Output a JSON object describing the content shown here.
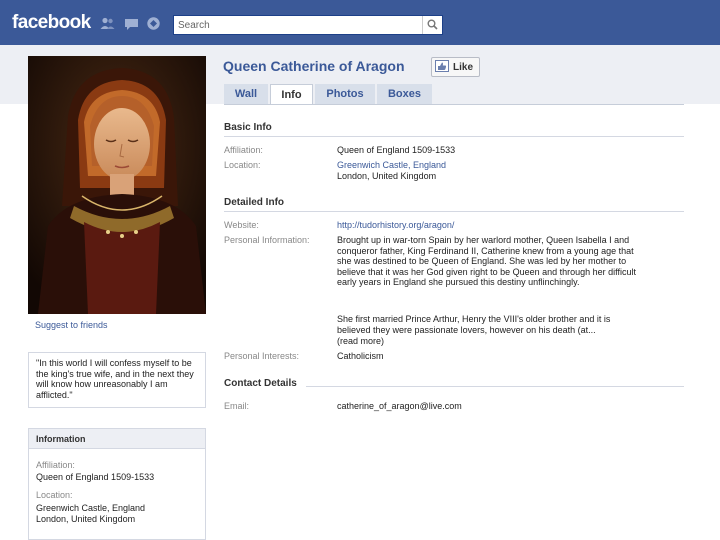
{
  "topbar": {
    "logo": "facebook",
    "icons": [
      "friends-icon",
      "messages-icon",
      "notifications-icon"
    ],
    "search_placeholder": "Search"
  },
  "profile": {
    "name": "Queen Catherine of Aragon",
    "like_label": "Like",
    "photo_description": "portrait-photo",
    "suggest_label": "Suggest to friends"
  },
  "tabs": [
    {
      "label": "Wall",
      "active": false
    },
    {
      "label": "Info",
      "active": true
    },
    {
      "label": "Photos",
      "active": false
    },
    {
      "label": "Boxes",
      "active": false
    }
  ],
  "basic_info": {
    "title": "Basic Info",
    "affiliation_label": "Affiliation:",
    "affiliation_value": "Queen of England 1509-1533",
    "location_label": "Location:",
    "location_link": "Greenwich Castle, England",
    "location_line2": "London, United Kingdom"
  },
  "detailed_info": {
    "title": "Detailed Info",
    "website_label": "Website:",
    "website_value": "http://tudorhistory.org/aragon/",
    "personal_label": "Personal Information:",
    "personal_p1": "Brought up in war-torn Spain by her warlord mother, Queen Isabella I and conqueror father, King Ferdinand II, Catherine knew from a young age that she was destined to be Queen of England. She was led by her mother to believe that it was her God given right to be Queen and through her difficult early years in England she pursued this destiny unflinchingly.",
    "personal_p2": "She first married Prince Arthur, Henry the VIII's older brother and it is believed they were passionate lovers, however on his death (at...",
    "read_more": "(read more)",
    "interests_label": "Personal Interests:",
    "interests_value": "Catholicism"
  },
  "contact": {
    "title": "Contact Details",
    "email_label": "Email:",
    "email_value": "catherine_of_aragon@live.com"
  },
  "sidebar": {
    "quote": "\"In this world I will confess myself to be the king's true wife, and in the next they will know how unreasonably I am afflicted.\"",
    "info_title": "Information",
    "affiliation_label": "Affiliation:",
    "affiliation_value": "Queen of England 1509-1533",
    "location_label": "Location:",
    "location_link": "Greenwich Castle, England",
    "location_line2": "London, United Kingdom"
  },
  "colors": {
    "brand": "#3b5998",
    "band": "#edeff4",
    "tab_inactive": "#d8dfea"
  }
}
